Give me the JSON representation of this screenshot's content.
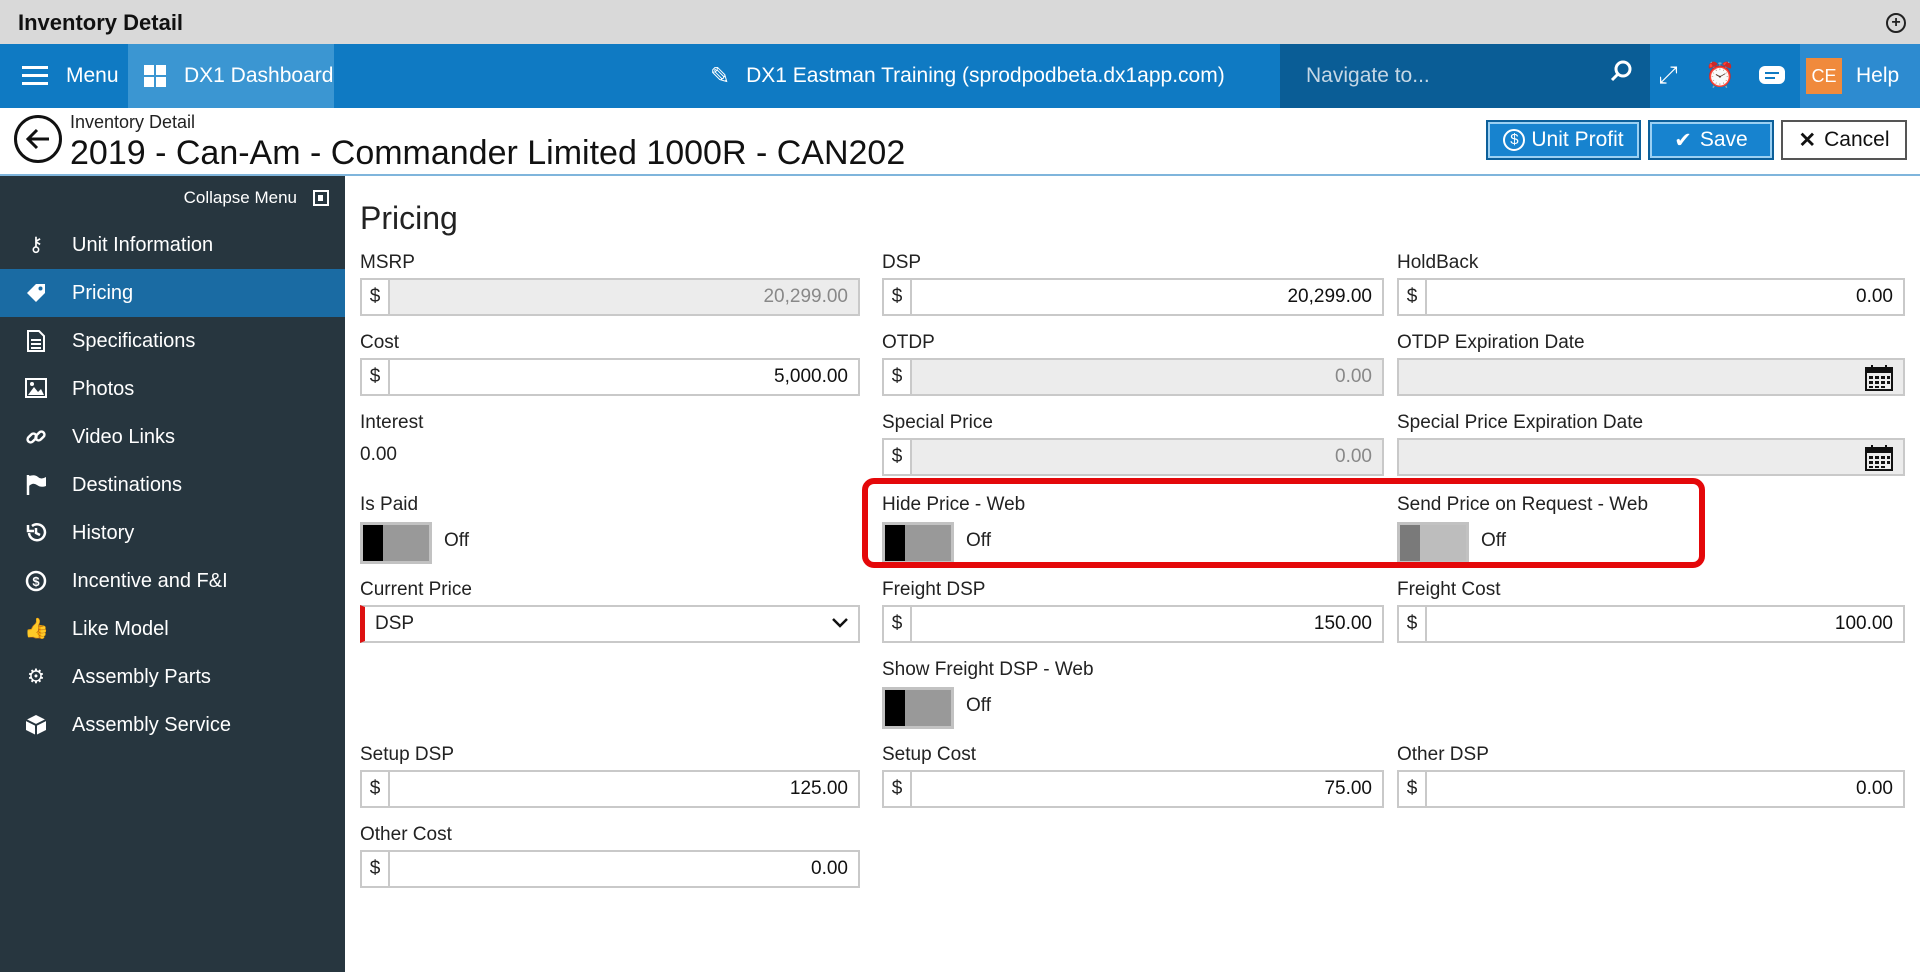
{
  "window": {
    "title": "Inventory Detail"
  },
  "topnav": {
    "menu_label": "Menu",
    "dashboard_label": "DX1 Dashboard",
    "site_label": "DX1 Eastman Training (sprodpodbeta.dx1app.com)",
    "search_placeholder": "Navigate to...",
    "avatar_initials": "CE",
    "help_label": "Help"
  },
  "header": {
    "breadcrumb": "Inventory Detail",
    "title": "2019 - Can-Am - Commander Limited 1000R - CAN202",
    "unit_profit_label": "Unit Profit",
    "save_label": "Save",
    "cancel_label": "Cancel"
  },
  "sidebar": {
    "collapse_label": "Collapse Menu",
    "items": [
      {
        "label": "Unit Information",
        "icon": "key-icon"
      },
      {
        "label": "Pricing",
        "icon": "tag-icon",
        "active": true
      },
      {
        "label": "Specifications",
        "icon": "document-icon"
      },
      {
        "label": "Photos",
        "icon": "image-icon"
      },
      {
        "label": "Video Links",
        "icon": "link-icon"
      },
      {
        "label": "Destinations",
        "icon": "flag-icon"
      },
      {
        "label": "History",
        "icon": "history-icon"
      },
      {
        "label": "Incentive and F&I",
        "icon": "dollar-circle-icon"
      },
      {
        "label": "Like Model",
        "icon": "thumbs-up-icon"
      },
      {
        "label": "Assembly Parts",
        "icon": "gear-icon"
      },
      {
        "label": "Assembly Service",
        "icon": "box-icon"
      }
    ]
  },
  "pricing": {
    "section_title": "Pricing",
    "currency_symbol": "$",
    "msrp": {
      "label": "MSRP",
      "value": "20,299.00"
    },
    "dsp": {
      "label": "DSP",
      "value": "20,299.00"
    },
    "holdback": {
      "label": "HoldBack",
      "value": "0.00"
    },
    "cost": {
      "label": "Cost",
      "value": "5,000.00"
    },
    "otdp": {
      "label": "OTDP",
      "value": "0.00"
    },
    "otdp_expiration": {
      "label": "OTDP Expiration Date",
      "value": ""
    },
    "interest": {
      "label": "Interest",
      "value": "0.00"
    },
    "special_price": {
      "label": "Special Price",
      "value": "0.00"
    },
    "special_price_expiration": {
      "label": "Special Price Expiration Date",
      "value": ""
    },
    "is_paid": {
      "label": "Is Paid",
      "state": "Off"
    },
    "hide_price_web": {
      "label": "Hide Price - Web",
      "state": "Off"
    },
    "send_price_on_request_web": {
      "label": "Send Price on Request - Web",
      "state": "Off"
    },
    "current_price": {
      "label": "Current Price",
      "value": "DSP"
    },
    "freight_dsp": {
      "label": "Freight DSP",
      "value": "150.00"
    },
    "freight_cost": {
      "label": "Freight Cost",
      "value": "100.00"
    },
    "show_freight_dsp_web": {
      "label": "Show Freight DSP - Web",
      "state": "Off"
    },
    "setup_dsp": {
      "label": "Setup DSP",
      "value": "125.00"
    },
    "setup_cost": {
      "label": "Setup Cost",
      "value": "75.00"
    },
    "other_dsp": {
      "label": "Other DSP",
      "value": "0.00"
    },
    "other_cost": {
      "label": "Other Cost",
      "value": "0.00"
    }
  },
  "colors": {
    "nav_blue": "#0f7ac3",
    "sidebar": "#27363f",
    "active_item": "#1a6ba3",
    "highlight": "#e4080a",
    "avatar": "#f08a3c"
  }
}
